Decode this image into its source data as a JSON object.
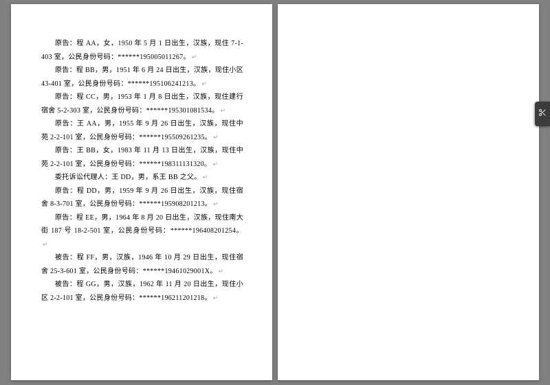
{
  "paragraphs": [
    "原告：程 AA，女，1950 年 5 月 1 日出生，汉族，现住 7-1-403 室，公民身份号码：******195005011267。",
    "原告：程 BB，男，1951 年 6 月 24 日出生，汉族，现住小区 43-401 室，公民身份号码：******195106241213。",
    "原告：程 CC，男，1953 年 1 月 8 日出生，汉族，现住建行宿舍 5-2-303 室，公民身份号码：******195301081534。",
    "原告：王 AA，男，1955 年 9 月 26 日出生，汉族，现住中苑 2-2-101 室，公民身份号码：******195509261235。",
    "原告：王 BB，女，1983 年 11 月 13 日出生，汉族，现住中苑 2-2-101 室，公民身份号码：******198311131320。",
    "委托诉讼代理人：王 DD，男，系王 BB 之父。",
    "原告：程 DD，男，1959 年 9 月 26 日出生，汉族，现住宿舍 8-3-701 室，公民身份号码：******195908201213。",
    "原告：程 EE，男，1964 年 8 月 20 日出生，汉族，现住南大街 187 号 18-2-501 室，公民身份号码：******196408201254。",
    "被告：程 FF，男，汉族，1946 年 10 月 29 日出生，现住宿舍 25-3-601 室，公民身份号码：******19461029001X。",
    "被告：程 GG，男，汉族，1962 年 11 月 20 日出生，现住小区 2-2-101 室，公民身份号码：******196211201218。"
  ],
  "side_tab_icon": "scissors-icon"
}
